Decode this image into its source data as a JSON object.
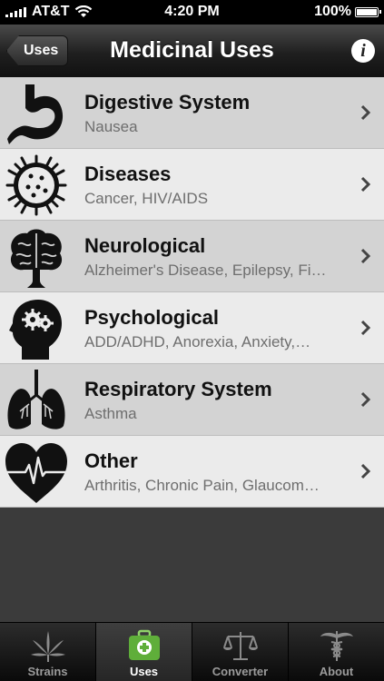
{
  "status_bar": {
    "carrier": "AT&T",
    "time": "4:20 PM",
    "battery": "100%",
    "battery_level": 1.0
  },
  "nav": {
    "back_label": "Uses",
    "title": "Medicinal Uses",
    "info_glyph": "i"
  },
  "uses": [
    {
      "title": "Digestive System",
      "subtitle": "Nausea",
      "icon": "stomach-icon"
    },
    {
      "title": "Diseases",
      "subtitle": "Cancer, HIV/AIDS",
      "icon": "virus-icon"
    },
    {
      "title": "Neurological",
      "subtitle": "Alzheimer's Disease, Epilepsy, Fi…",
      "icon": "brain-icon"
    },
    {
      "title": "Psychological",
      "subtitle": "ADD/ADHD, Anorexia, Anxiety,…",
      "icon": "head-gears-icon"
    },
    {
      "title": "Respiratory System",
      "subtitle": "Asthma",
      "icon": "lungs-icon"
    },
    {
      "title": "Other",
      "subtitle": "Arthritis, Chronic Pain, Glaucom…",
      "icon": "heart-pulse-icon"
    }
  ],
  "tabs": [
    {
      "label": "Strains",
      "icon": "cannabis-leaf-icon",
      "active": false
    },
    {
      "label": "Uses",
      "icon": "first-aid-kit-icon",
      "active": true
    },
    {
      "label": "Converter",
      "icon": "scales-icon",
      "active": false
    },
    {
      "label": "About",
      "icon": "caduceus-icon",
      "active": false
    }
  ]
}
